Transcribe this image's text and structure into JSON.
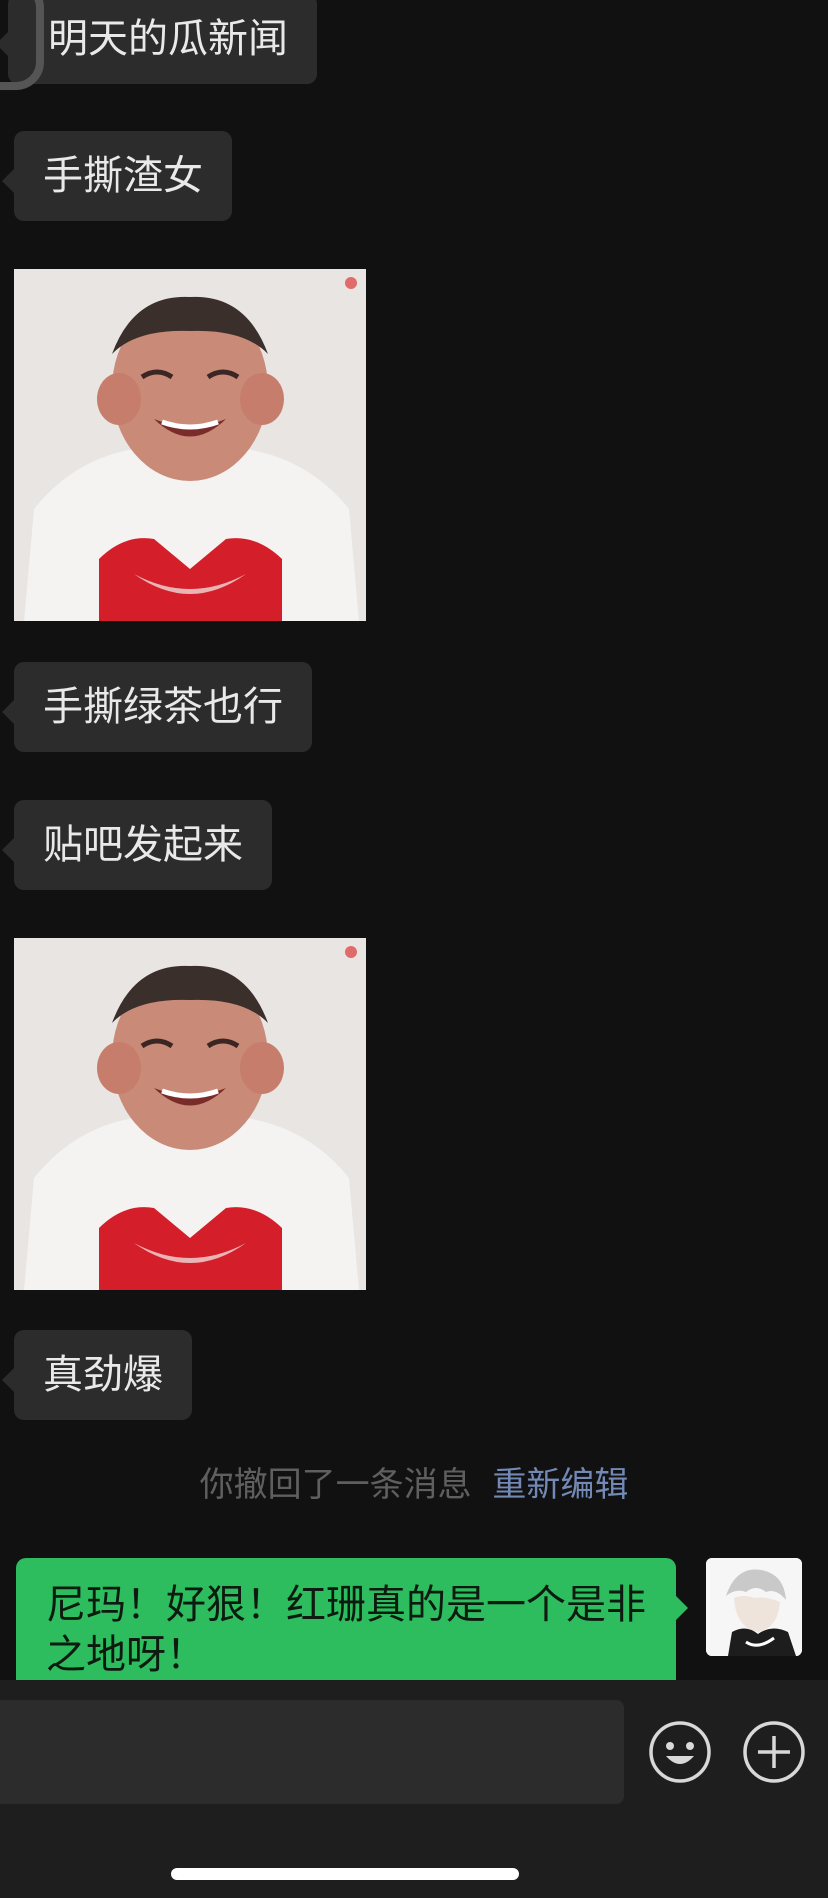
{
  "colors": {
    "background": "#111111",
    "received_bubble": "#2c2c2c",
    "sent_bubble": "#2dbd5e",
    "reedit_link": "#7289b5"
  },
  "messages": [
    {
      "type": "text",
      "side": "left",
      "text": "明天的瓜新闻"
    },
    {
      "type": "text",
      "side": "left",
      "text": "手撕渣女"
    },
    {
      "type": "sticker",
      "side": "left",
      "content": "laughing-child-sticker"
    },
    {
      "type": "text",
      "side": "left",
      "text": "手撕绿茶也行"
    },
    {
      "type": "text",
      "side": "left",
      "text": "贴吧发起来"
    },
    {
      "type": "sticker",
      "side": "left",
      "content": "laughing-child-sticker"
    },
    {
      "type": "text",
      "side": "left",
      "text": "真劲爆"
    }
  ],
  "system_notice": {
    "text": "你撤回了一条消息",
    "action": "重新编辑"
  },
  "sent_message": {
    "text": "尼玛！好狠！红珊真的是一个是非之地呀！"
  },
  "input_bar": {
    "value": "",
    "emoji_icon": "emoji-icon",
    "plus_icon": "plus-circle-icon"
  }
}
